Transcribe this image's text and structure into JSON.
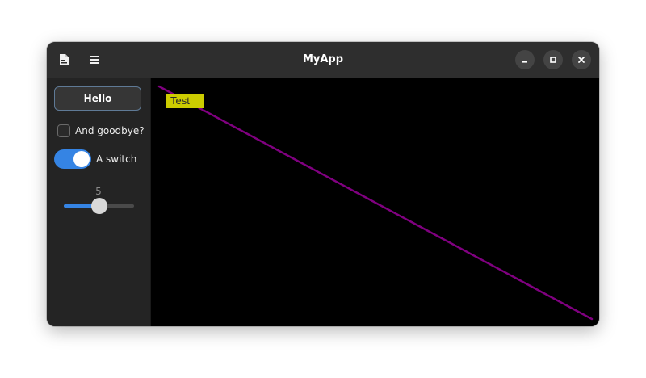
{
  "window": {
    "title": "MyApp"
  },
  "headerbar": {
    "left_icons": [
      "new-document-icon",
      "hamburger-menu-icon"
    ],
    "controls": [
      "minimize-icon",
      "maximize-icon",
      "close-icon"
    ]
  },
  "sidebar": {
    "hello_button": "Hello",
    "checkbox_label": "And goodbye?",
    "checkbox_checked": false,
    "switch_label": "A switch",
    "switch_on": true,
    "slider_value": "5",
    "slider_fraction": 0.5
  },
  "canvas": {
    "label_text": "Test",
    "line_color": "#800080",
    "label_bg": "#cccc00",
    "background": "#000000"
  },
  "colors": {
    "accent": "#3584e4",
    "headerbar": "#2e2e2e",
    "sidebar": "#242424"
  }
}
